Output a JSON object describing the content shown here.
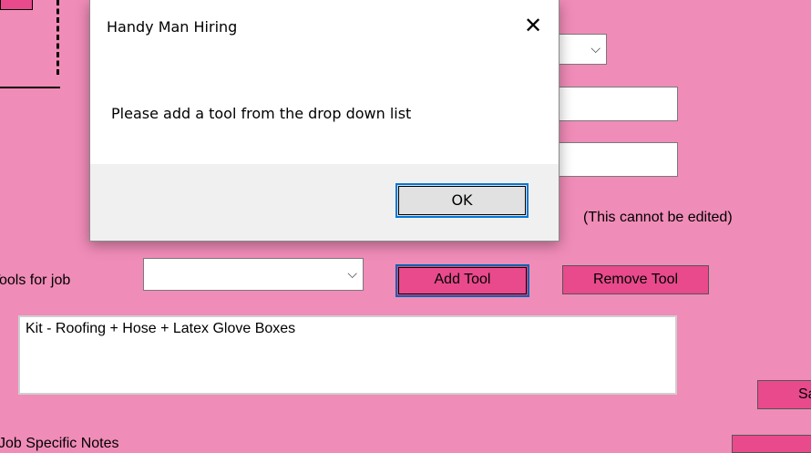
{
  "form": {
    "tools_label": "Tools for job",
    "cannot_edit_note": "(This cannot be edited)",
    "add_tool": "Add Tool",
    "remove_tool": "Remove Tool",
    "tools_list_text": "Kit - Roofing + Hose + Latex Glove Boxes",
    "save_partial": "Sa",
    "notes_label_partial": "Job Specific Notes",
    "tool_dropdown_value": ""
  },
  "dialog": {
    "title": "Handy Man Hiring",
    "message": "Please add a tool from the drop down list",
    "ok_label": "OK",
    "close_glyph": "✕"
  },
  "icons": {
    "dropdown_arrow": "chevron-down-icon",
    "close": "close-icon"
  }
}
